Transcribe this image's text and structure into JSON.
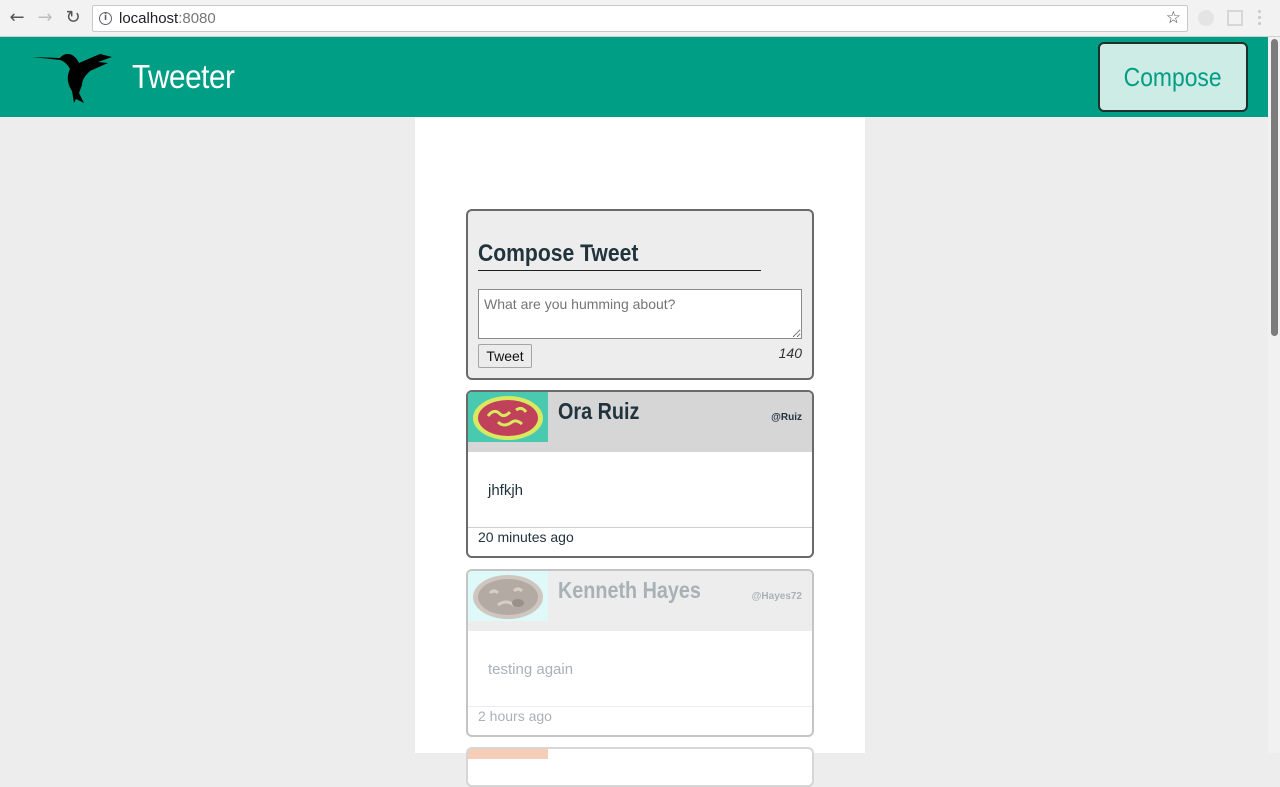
{
  "browser": {
    "url_host": "localhost",
    "url_port": ":8080"
  },
  "app": {
    "title": "Tweeter",
    "compose_button": "Compose"
  },
  "compose": {
    "heading": "Compose Tweet",
    "placeholder": "What are you humming about?",
    "tweet_button": "Tweet",
    "counter": "140"
  },
  "tweets": [
    {
      "name": "Ora Ruiz",
      "handle": "@Ruiz",
      "content": "jhfkjh",
      "time": "20 minutes ago",
      "avatar_bg": "#48c9b0",
      "avatar_face": "#c1405a",
      "avatar_ring": "#d9e85f"
    },
    {
      "name": "Kenneth Hayes",
      "handle": "@Hayes72",
      "content": "testing again",
      "time": "2 hours ago",
      "avatar_bg": "#dff8f8",
      "avatar_face": "#b3aaa3",
      "avatar_ring": "#cfc7bf"
    }
  ],
  "colors": {
    "header": "#009e84",
    "page_bg": "#ededed",
    "text_dark": "#21333d"
  }
}
